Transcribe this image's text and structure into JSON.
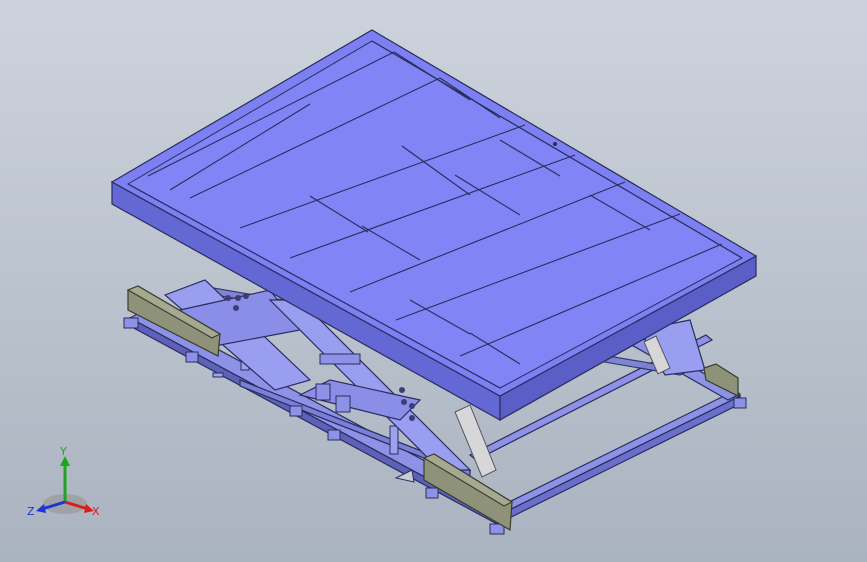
{
  "viewport": {
    "background_top": "#cdd3dc",
    "background_bottom": "#aab3c0"
  },
  "model": {
    "platform_color": "#7c80f2",
    "platform_edge_color": "#2a2c5e",
    "frame_color": "#8d92e6",
    "bumper_color": "#8e9278",
    "cylinder_color": "#d7d7da"
  },
  "triad": {
    "x_label": "X",
    "y_label": "Y",
    "z_label": "Z",
    "x_color": "#d62020",
    "y_color": "#1ea51e",
    "z_color": "#1b35d8"
  }
}
